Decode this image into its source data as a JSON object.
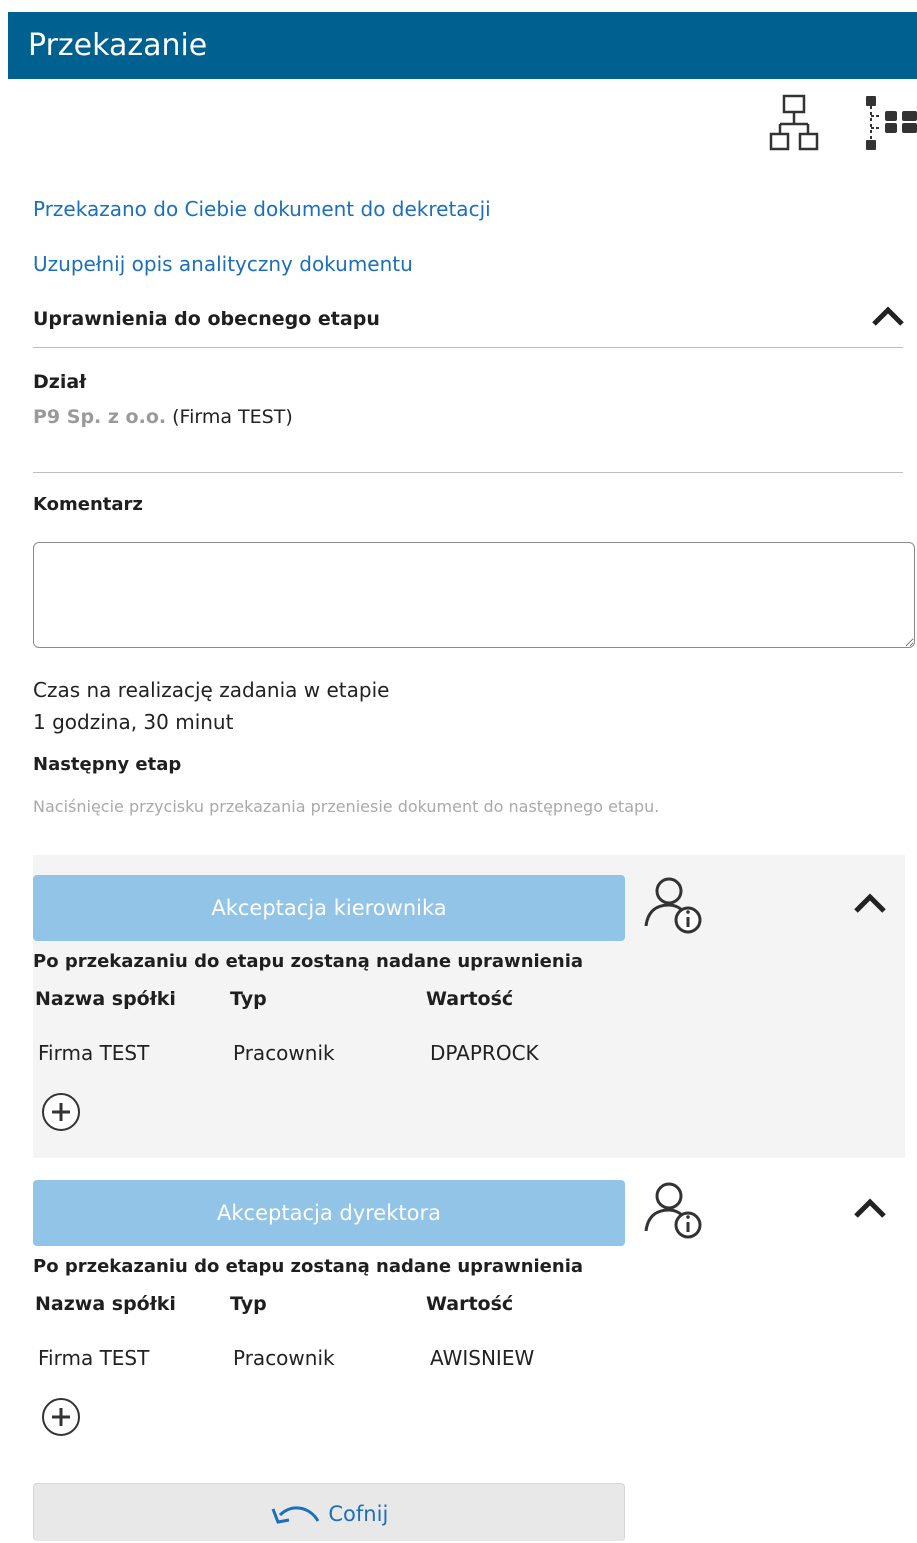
{
  "header": {
    "title": "Przekazanie"
  },
  "toolbar": {
    "icons": [
      "hierarchy-icon",
      "tree-list-icon"
    ]
  },
  "links": {
    "forwarded": "Przekazano do Ciebie dokument do dekretacji",
    "complete_description": "Uzupełnij opis analityczny dokumentu"
  },
  "permissions": {
    "title": "Uprawnienia do obecnego etapu",
    "department_label": "Dział",
    "department_company": "P9 Sp. z o.o.",
    "department_firm": "(Firma TEST)"
  },
  "comment": {
    "label": "Komentarz",
    "value": "",
    "placeholder": ""
  },
  "time": {
    "label": "Czas na realizację zadania w etapie",
    "value": "1 godzina, 30 minut"
  },
  "next_stage": {
    "label": "Następny etap",
    "hint": "Naciśnięcie przycisku przekazania przeniesie dokument do następnego etapu."
  },
  "stages": [
    {
      "button": "Akceptacja kierownika",
      "permissions_title": "Po przekazaniu do etapu zostaną nadane uprawnienia",
      "columns": [
        "Nazwa spółki",
        "Typ",
        "Wartość"
      ],
      "rows": [
        [
          "Firma TEST",
          "Pracownik",
          "DPAPROCK"
        ]
      ]
    },
    {
      "button": "Akceptacja dyrektora",
      "permissions_title": "Po przekazaniu do etapu zostaną nadane uprawnienia",
      "columns": [
        "Nazwa spółki",
        "Typ",
        "Wartość"
      ],
      "rows": [
        [
          "Firma TEST",
          "Pracownik",
          "AWISNIEW"
        ]
      ]
    }
  ],
  "back_button": {
    "label": "Cofnij"
  },
  "colors": {
    "header": "#00608f",
    "link": "#1c6fb8",
    "stage_button": "#92c4e7",
    "panel": "#f4f4f4"
  }
}
